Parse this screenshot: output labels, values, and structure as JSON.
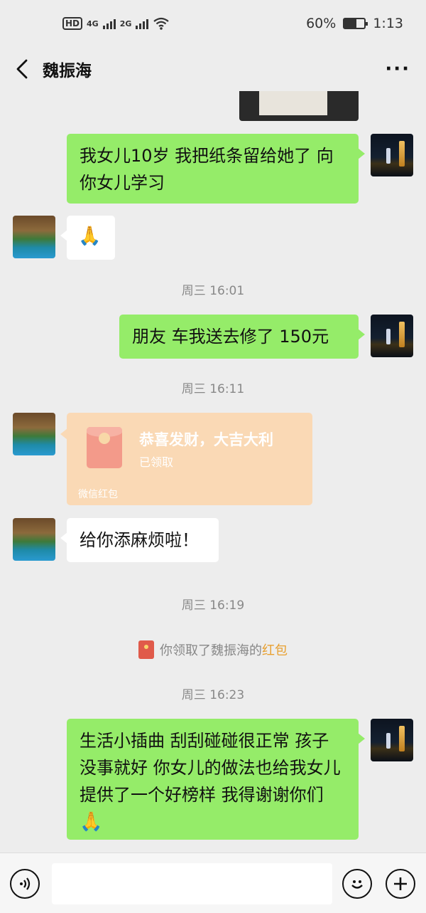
{
  "status_bar": {
    "network": "HD",
    "signal_1": "4G",
    "signal_2": "2G",
    "battery_percent": "60%",
    "battery_level": 0.6,
    "time": "1:13"
  },
  "header": {
    "back_icon": "chevron-left-icon",
    "title": "魏振海",
    "more_icon": "more-dots-icon",
    "more_label": "···"
  },
  "messages": {
    "m1": "我女儿10岁 我把纸条留给她了 向你女儿学习",
    "m2_emoji": "🙏",
    "t1": "周三 16:01",
    "m3": "朋友 车我送去修了 150元",
    "t2": "周三 16:11",
    "redpacket": {
      "title": "恭喜发财，大吉大利",
      "status": "已领取",
      "footer": "微信红包"
    },
    "m4": "给你添麻烦啦！",
    "t3": "周三 16:19",
    "system_note": {
      "text": "你领取了魏振海的",
      "link": "红包"
    },
    "t4": "周三 16:23",
    "m5": "生活小插曲 刮刮碰碰很正常 孩子没事就好 你女儿的做法也给我女儿提供了一个好榜样 我得谢谢你们",
    "m5_emoji": "🙏"
  },
  "input_bar": {
    "voice_icon": "voice-icon",
    "emoji_icon": "emoji-icon",
    "plus_icon": "plus-icon"
  },
  "colors": {
    "background": "#ededed",
    "bubble_mine": "#95ec69",
    "bubble_theirs": "#ffffff",
    "redpacket": "#fad9b5",
    "link": "#e8a030"
  }
}
